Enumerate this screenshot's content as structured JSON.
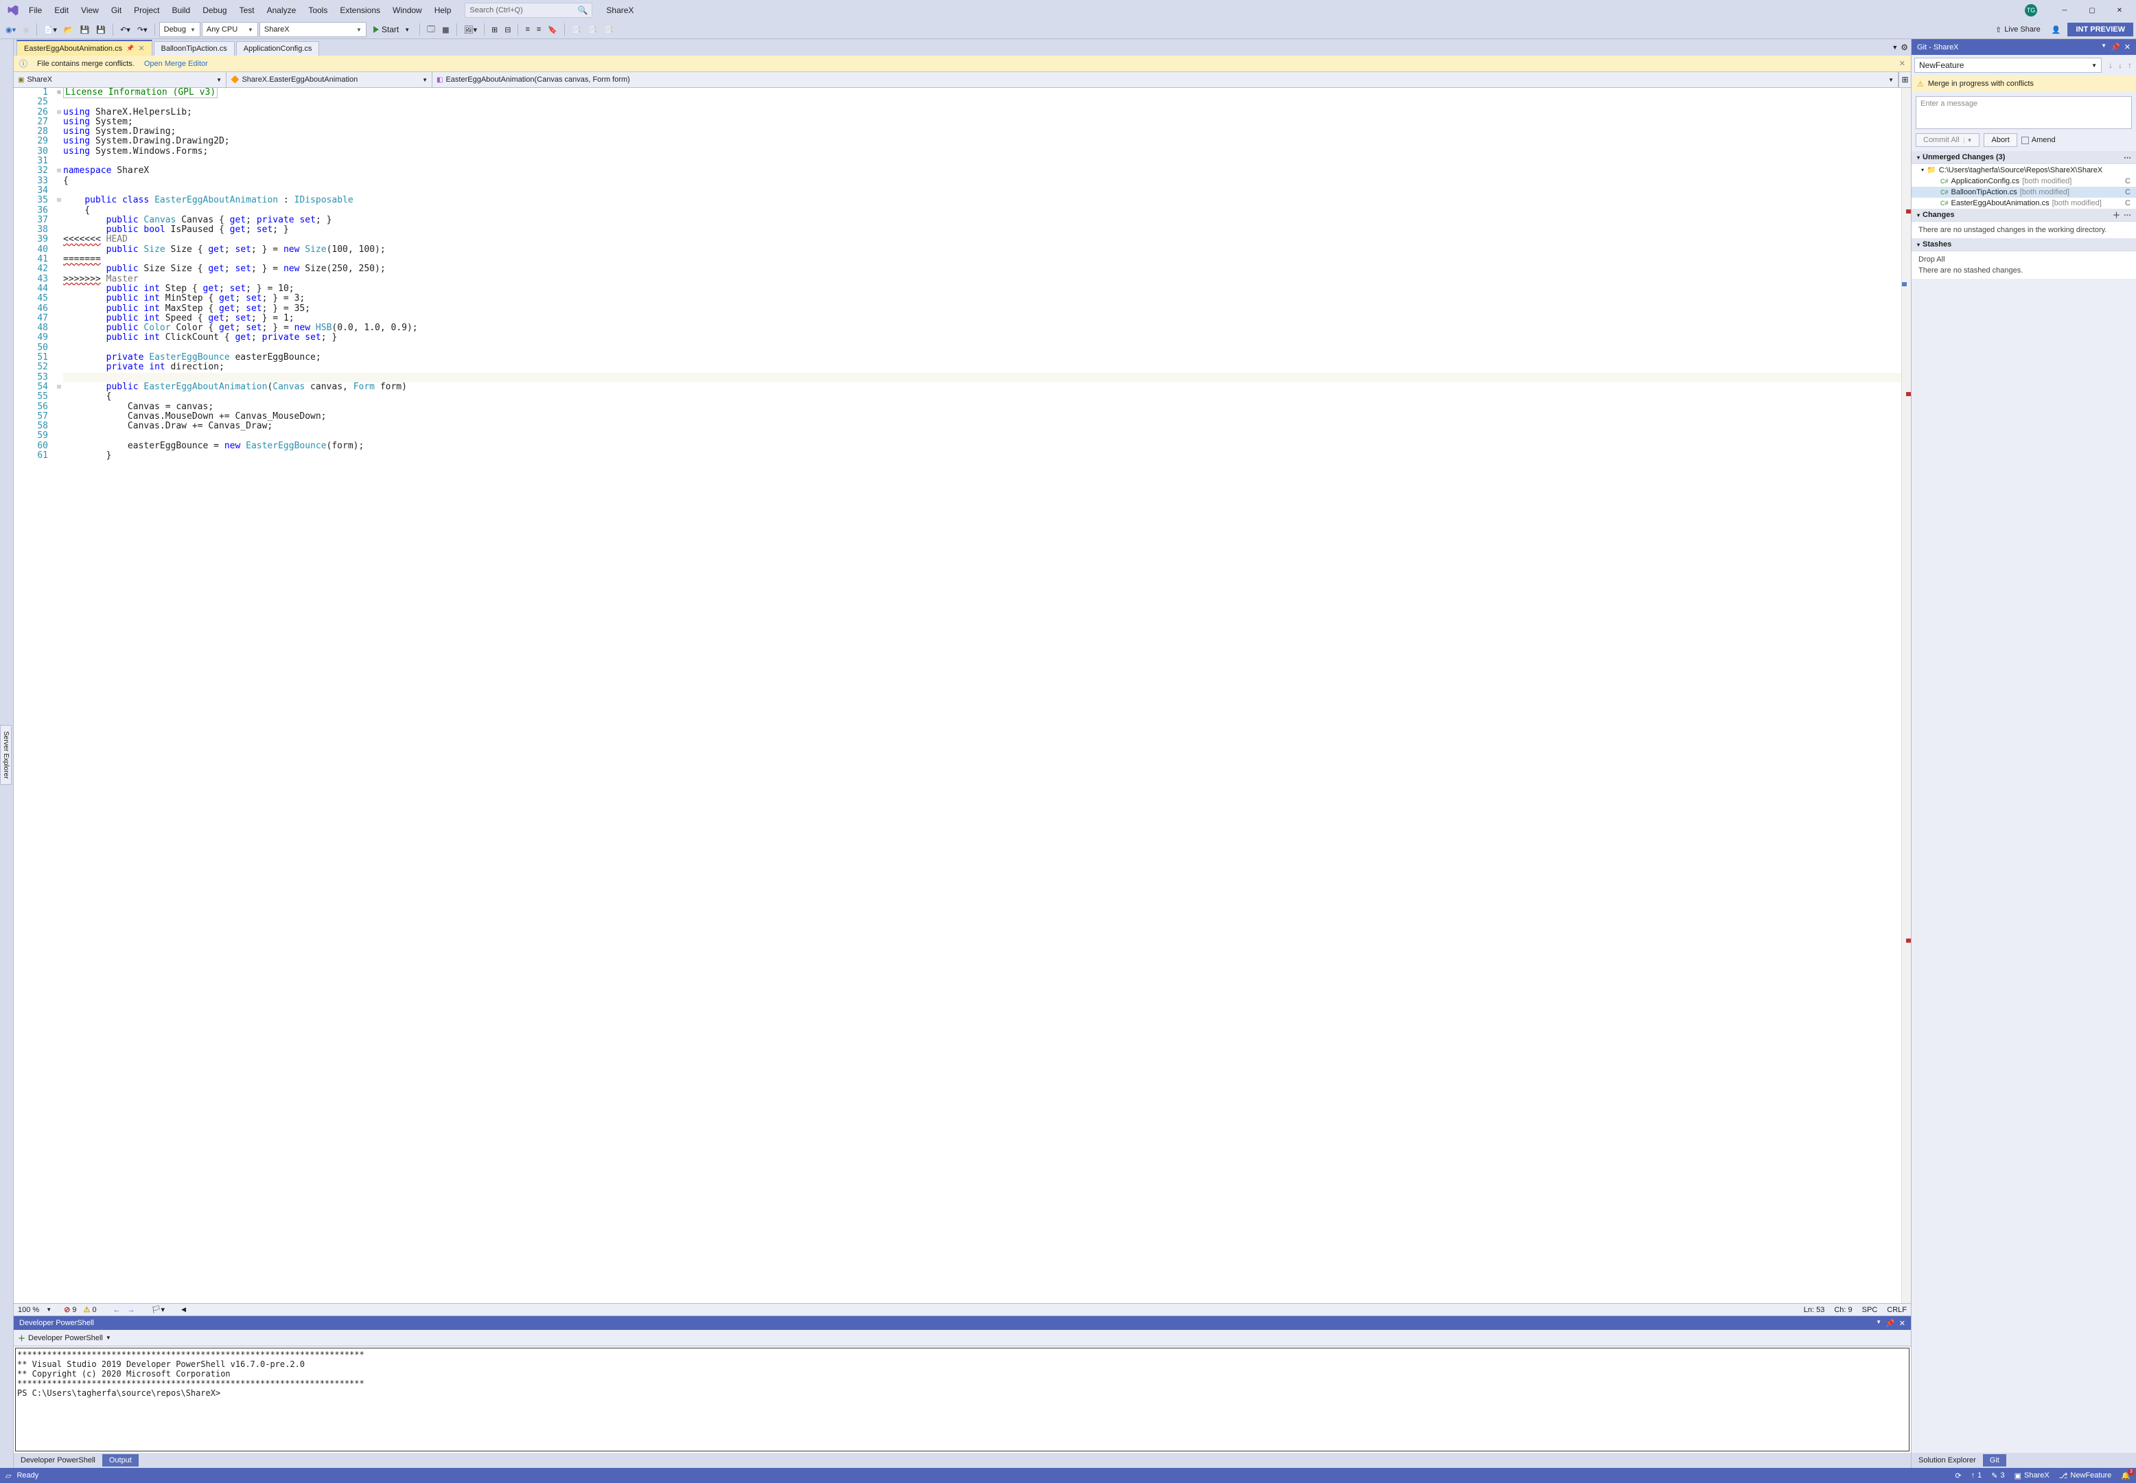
{
  "menus": [
    "File",
    "Edit",
    "View",
    "Git",
    "Project",
    "Build",
    "Debug",
    "Test",
    "Analyze",
    "Tools",
    "Extensions",
    "Window",
    "Help"
  ],
  "title_search_placeholder": "Search (Ctrl+Q)",
  "solution_name": "ShareX",
  "avatar_initials": "TG",
  "toolbar": {
    "config": "Debug",
    "platform": "Any CPU",
    "startup": "ShareX",
    "start": "Start",
    "live_share": "Live Share",
    "int_preview": "INT PREVIEW"
  },
  "doc_tabs": [
    {
      "label": "EasterEggAboutAnimation.cs",
      "active": true,
      "pinned": true
    },
    {
      "label": "BalloonTipAction.cs",
      "active": false
    },
    {
      "label": "ApplicationConfig.cs",
      "active": false
    }
  ],
  "merge_bar": {
    "msg": "File contains merge conflicts.",
    "link": "Open Merge Editor"
  },
  "nav": {
    "scope": "ShareX",
    "class": "ShareX.EasterEggAboutAnimation",
    "member": "EasterEggAboutAnimation(Canvas canvas, Form form)"
  },
  "code": [
    {
      "n": 1,
      "fold": "+",
      "html": "<span class='com'>License Information (GPL v3)</span>",
      "box": true
    },
    {
      "n": 25,
      "html": ""
    },
    {
      "n": 26,
      "fold": "-",
      "html": "<span class='kw'>using</span> ShareX.HelpersLib;"
    },
    {
      "n": 27,
      "html": "<span class='kw'>using</span> System;"
    },
    {
      "n": 28,
      "html": "<span class='kw'>using</span> System.Drawing;"
    },
    {
      "n": 29,
      "html": "<span class='kw'>using</span> System.Drawing.Drawing2D;"
    },
    {
      "n": 30,
      "html": "<span class='kw'>using</span> System.Windows.Forms;"
    },
    {
      "n": 31,
      "html": ""
    },
    {
      "n": 32,
      "fold": "-",
      "html": "<span class='kw'>namespace</span> ShareX"
    },
    {
      "n": 33,
      "html": "{"
    },
    {
      "n": 34,
      "html": ""
    },
    {
      "n": 35,
      "fold": "-",
      "html": "    <span class='kw'>public</span> <span class='kw'>class</span> <span class='cls'>EasterEggAboutAnimation</span> : <span class='cls'>IDisposable</span>"
    },
    {
      "n": 36,
      "html": "    {"
    },
    {
      "n": 37,
      "html": "        <span class='kw'>public</span> <span class='cls'>Canvas</span> Canvas { <span class='kw'>get</span>; <span class='kw'>private</span> <span class='kw'>set</span>; }"
    },
    {
      "n": 38,
      "html": "        <span class='kw'>public</span> <span class='kw'>bool</span> IsPaused { <span class='kw'>get</span>; <span class='kw'>set</span>; }"
    },
    {
      "n": 39,
      "html": "<span class='err'>&lt;&lt;&lt;&lt;&lt;&lt;&lt;</span> <span class='mrg'>HEAD</span>"
    },
    {
      "n": 40,
      "html": "        <span class='kw'>public</span> <span class='cls'>Size</span> Size { <span class='kw'>get</span>; <span class='kw'>set</span>; } = <span class='kw'>new</span> <span class='cls'>Size</span>(100, 100);"
    },
    {
      "n": 41,
      "html": "<span class='err'>=======</span>"
    },
    {
      "n": 42,
      "html": "        <span class='kw'>public</span> Size Size { <span class='kw'>get</span>; <span class='kw'>set</span>; } = <span class='kw'>new</span> Size(250, 250);"
    },
    {
      "n": 43,
      "html": "<span class='err'>&gt;&gt;&gt;&gt;&gt;&gt;&gt;</span> <span class='mrg'>Master</span>"
    },
    {
      "n": 44,
      "html": "        <span class='kw'>public</span> <span class='kw'>int</span> Step { <span class='kw'>get</span>; <span class='kw'>set</span>; } = 10;"
    },
    {
      "n": 45,
      "html": "        <span class='kw'>public</span> <span class='kw'>int</span> MinStep { <span class='kw'>get</span>; <span class='kw'>set</span>; } = 3;"
    },
    {
      "n": 46,
      "html": "        <span class='kw'>public</span> <span class='kw'>int</span> MaxStep { <span class='kw'>get</span>; <span class='kw'>set</span>; } = 35;"
    },
    {
      "n": 47,
      "html": "        <span class='kw'>public</span> <span class='kw'>int</span> Speed { <span class='kw'>get</span>; <span class='kw'>set</span>; } = 1;"
    },
    {
      "n": 48,
      "html": "        <span class='kw'>public</span> <span class='cls'>Color</span> Color { <span class='kw'>get</span>; <span class='kw'>set</span>; } = <span class='kw'>new</span> <span class='cls'>HSB</span>(0.0, 1.0, 0.9);"
    },
    {
      "n": 49,
      "html": "        <span class='kw'>public</span> <span class='kw'>int</span> ClickCount { <span class='kw'>get</span>; <span class='kw'>private</span> <span class='kw'>set</span>; }"
    },
    {
      "n": 50,
      "html": ""
    },
    {
      "n": 51,
      "html": "        <span class='kw'>private</span> <span class='cls'>EasterEggBounce</span> easterEggBounce;"
    },
    {
      "n": 52,
      "html": "        <span class='kw'>private</span> <span class='kw'>int</span> direction;"
    },
    {
      "n": 53,
      "html": "        ",
      "cur": true,
      "mod": true
    },
    {
      "n": 54,
      "fold": "-",
      "html": "        <span class='kw'>public</span> <span class='cls'>EasterEggAboutAnimation</span>(<span class='cls'>Canvas</span> canvas, <span class='cls'>Form</span> form)"
    },
    {
      "n": 55,
      "html": "        {"
    },
    {
      "n": 56,
      "html": "            Canvas = canvas;"
    },
    {
      "n": 57,
      "html": "            Canvas.MouseDown += Canvas_MouseDown;"
    },
    {
      "n": 58,
      "html": "            Canvas.Draw += Canvas_Draw;"
    },
    {
      "n": 59,
      "html": ""
    },
    {
      "n": 60,
      "html": "            easterEggBounce = <span class='kw'>new</span> <span class='cls'>EasterEggBounce</span>(form);"
    },
    {
      "n": 61,
      "html": "        }"
    }
  ],
  "editor_status": {
    "zoom": "100 %",
    "errors": "9",
    "warnings": "0",
    "ln": "Ln: 53",
    "ch": "Ch: 9",
    "enc": "SPC",
    "eol": "CRLF"
  },
  "ps_panel_title": "Developer PowerShell",
  "ps_toolbar_label": "Developer PowerShell",
  "ps_lines": [
    "**********************************************************************",
    "** Visual Studio 2019 Developer PowerShell v16.7.0-pre.2.0",
    "** Copyright (c) 2020 Microsoft Corporation",
    "**********************************************************************",
    "PS C:\\Users\\tagherfa\\source\\repos\\ShareX>"
  ],
  "bottom_tabs": [
    {
      "label": "Developer PowerShell",
      "active": false
    },
    {
      "label": "Output",
      "active": true
    }
  ],
  "git_panel": {
    "title": "Git - ShareX",
    "branch": "NewFeature",
    "warn": "Merge in progress with conflicts",
    "commit_placeholder": "Enter a message",
    "commit_btn": "Commit All",
    "abort_btn": "Abort",
    "amend": "Amend",
    "unmerged_hdr": "Unmerged Changes (3)",
    "repo_path": "C:\\Users\\tagherfa\\Source\\Repos\\ShareX\\ShareX",
    "unmerged": [
      {
        "name": "ApplicationConfig.cs",
        "status": "[both modified]",
        "r": "C"
      },
      {
        "name": "BalloonTipAction.cs",
        "status": "[both modified]",
        "r": "C",
        "sel": true
      },
      {
        "name": "EasterEggAboutAnimation.cs",
        "status": "[both modified]",
        "r": "C"
      }
    ],
    "changes_hdr": "Changes",
    "changes_note": "There are no unstaged changes in the working directory.",
    "stashes_hdr": "Stashes",
    "drop_all": "Drop All",
    "stashes_note": "There are no stashed changes."
  },
  "rp_bottom_tabs": [
    {
      "label": "Solution Explorer",
      "active": false
    },
    {
      "label": "Git",
      "active": true
    }
  ],
  "status_bar": {
    "ready": "Ready",
    "up": "1",
    "pencil": "3",
    "repo": "ShareX",
    "branch": "NewFeature",
    "bell": "3"
  }
}
